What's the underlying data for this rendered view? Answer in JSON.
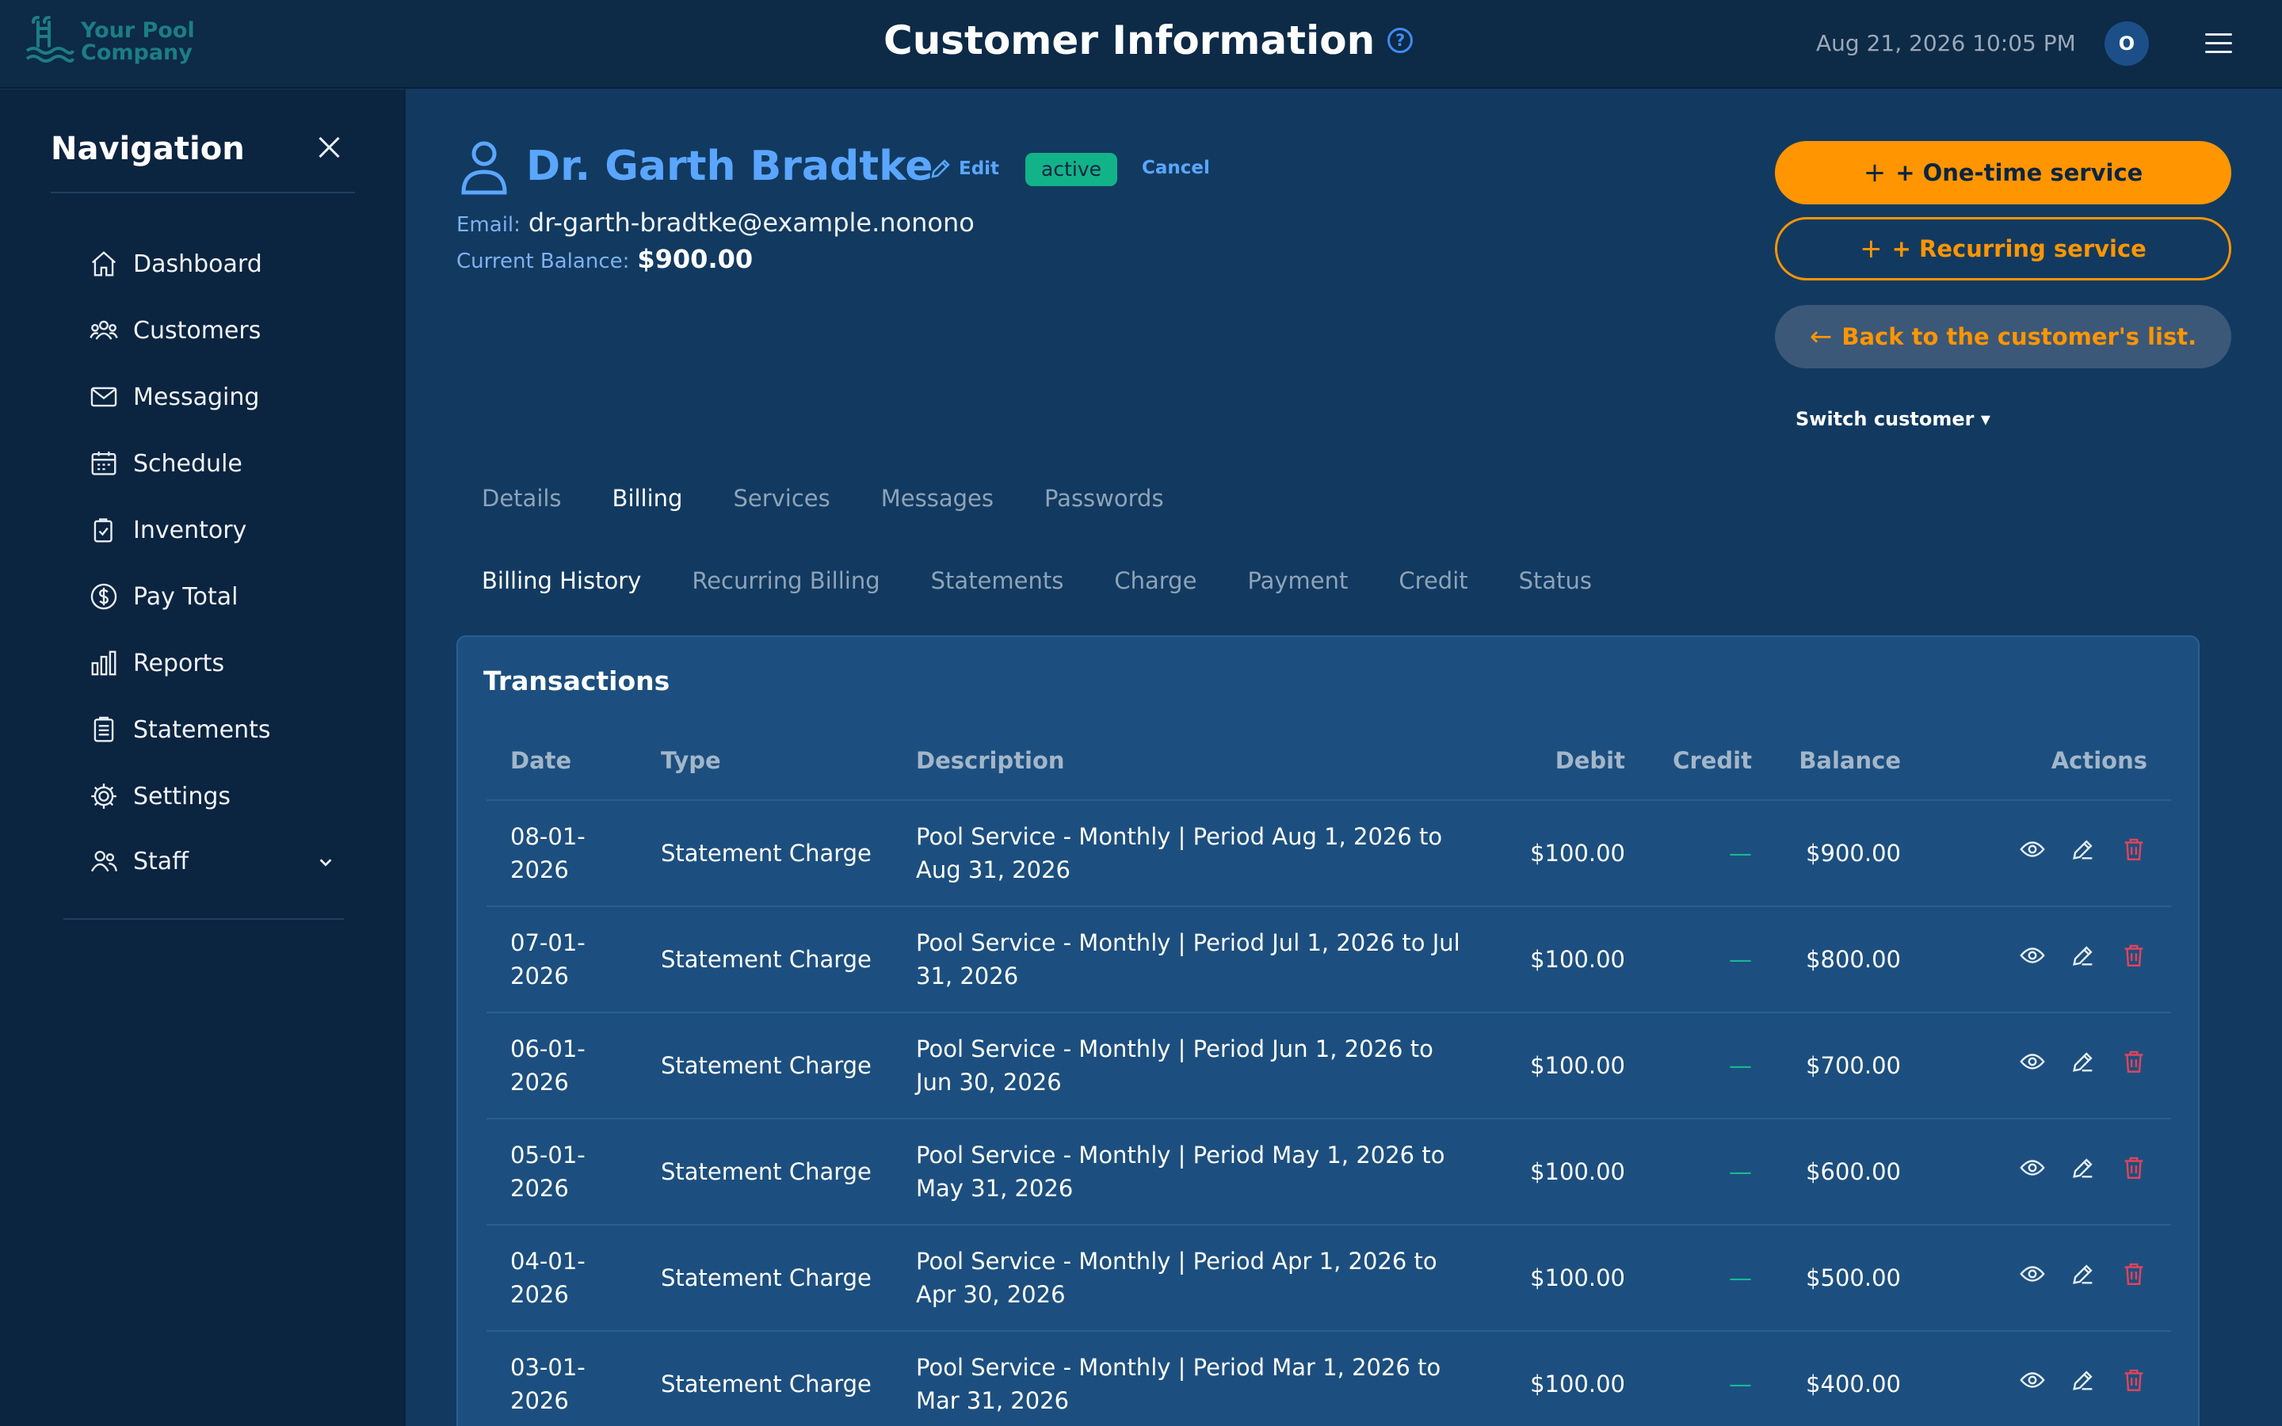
{
  "header": {
    "logo_line1": "Your Pool",
    "logo_line2": "Company",
    "title": "Customer Information",
    "help_glyph": "?",
    "datetime": "Aug 21, 2026 10:05 PM",
    "avatar_initial": "O"
  },
  "sidebar": {
    "title": "Navigation",
    "items": [
      {
        "label": "Dashboard",
        "icon": "home-icon"
      },
      {
        "label": "Customers",
        "icon": "users-icon"
      },
      {
        "label": "Messaging",
        "icon": "mail-icon"
      },
      {
        "label": "Schedule",
        "icon": "calendar-icon"
      },
      {
        "label": "Inventory",
        "icon": "clipboard-check-icon"
      },
      {
        "label": "Pay Total",
        "icon": "dollar-circle-icon"
      },
      {
        "label": "Reports",
        "icon": "bar-chart-icon"
      },
      {
        "label": "Statements",
        "icon": "document-icon"
      },
      {
        "label": "Settings",
        "icon": "gear-icon"
      },
      {
        "label": "Staff",
        "icon": "staff-icon"
      }
    ]
  },
  "customer": {
    "name": "Dr. Garth Bradtke",
    "edit_label": "Edit",
    "status": "active",
    "cancel_label": "Cancel",
    "email_label": "Email:",
    "email": "dr-garth-bradtke@example.nonono",
    "balance_label": "Current Balance:",
    "balance": "$900.00"
  },
  "actions": {
    "one_time": "+ One-time service",
    "recurring": "+ Recurring service",
    "back": "Back to the customer's list.",
    "switch_customer": "Switch customer ▾"
  },
  "tabs": [
    "Details",
    "Billing",
    "Services",
    "Messages",
    "Passwords"
  ],
  "active_tab": "Billing",
  "subtabs": [
    "Billing History",
    "Recurring Billing",
    "Statements",
    "Charge",
    "Payment",
    "Credit",
    "Status"
  ],
  "active_subtab": "Billing History",
  "transactions": {
    "title": "Transactions",
    "columns": [
      "Date",
      "Type",
      "Description",
      "Debit",
      "Credit",
      "Balance",
      "Actions"
    ],
    "rows": [
      {
        "date": "08-01-2026",
        "type": "Statement Charge",
        "description": "Pool Service - Monthly | Period Aug 1, 2026 to Aug 31, 2026",
        "debit": "$100.00",
        "credit": "—",
        "balance": "$900.00"
      },
      {
        "date": "07-01-2026",
        "type": "Statement Charge",
        "description": "Pool Service - Monthly | Period Jul 1, 2026 to Jul 31, 2026",
        "debit": "$100.00",
        "credit": "—",
        "balance": "$800.00"
      },
      {
        "date": "06-01-2026",
        "type": "Statement Charge",
        "description": "Pool Service - Monthly | Period Jun 1, 2026 to Jun 30, 2026",
        "debit": "$100.00",
        "credit": "—",
        "balance": "$700.00"
      },
      {
        "date": "05-01-2026",
        "type": "Statement Charge",
        "description": "Pool Service - Monthly | Period May 1, 2026 to May 31, 2026",
        "debit": "$100.00",
        "credit": "—",
        "balance": "$600.00"
      },
      {
        "date": "04-01-2026",
        "type": "Statement Charge",
        "description": "Pool Service - Monthly | Period Apr 1, 2026 to Apr 30, 2026",
        "debit": "$100.00",
        "credit": "—",
        "balance": "$500.00"
      },
      {
        "date": "03-01-2026",
        "type": "Statement Charge",
        "description": "Pool Service - Monthly | Period Mar 1, 2026 to Mar 31, 2026",
        "debit": "$100.00",
        "credit": "—",
        "balance": "$400.00"
      }
    ]
  },
  "colors": {
    "accent": "#ff9500",
    "link": "#5aa6ff",
    "status_active": "#12b389",
    "delete": "#e0445a"
  }
}
